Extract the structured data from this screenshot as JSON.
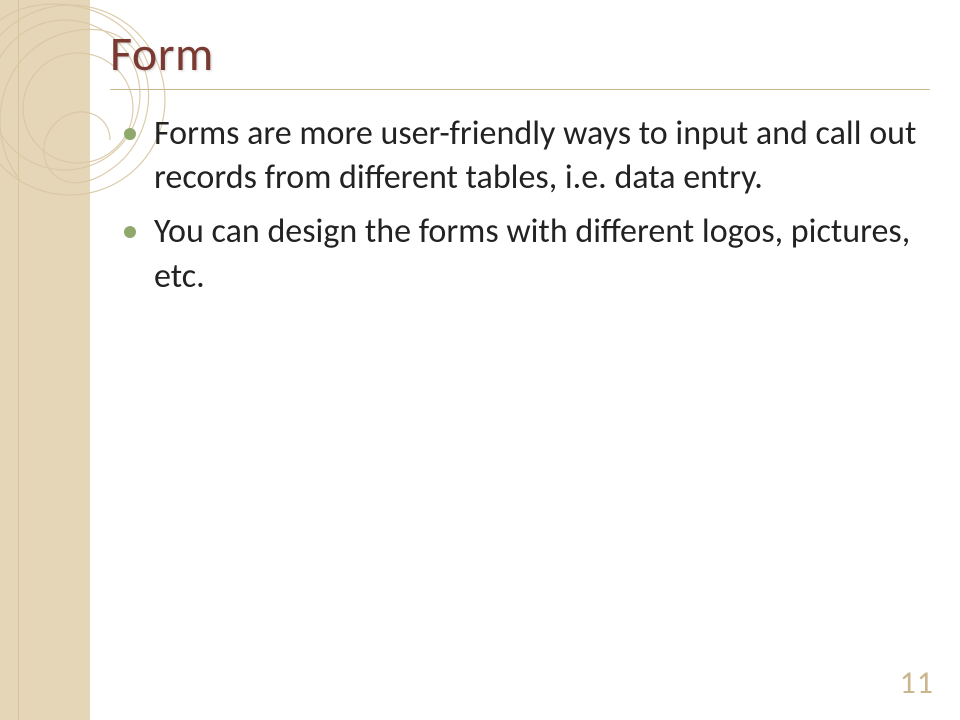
{
  "slide": {
    "title": "Form",
    "bullets": [
      "Forms are more user-friendly ways to input and call out records from different tables, i.e. data entry.",
      "You can design the forms with different logos, pictures, etc."
    ],
    "page_number": "11"
  },
  "colors": {
    "band": "#e6d6b8",
    "title": "#7a3a32",
    "bullet": "#8fa86b",
    "underline": "#c9b68d",
    "page_number": "#c9b68d"
  }
}
